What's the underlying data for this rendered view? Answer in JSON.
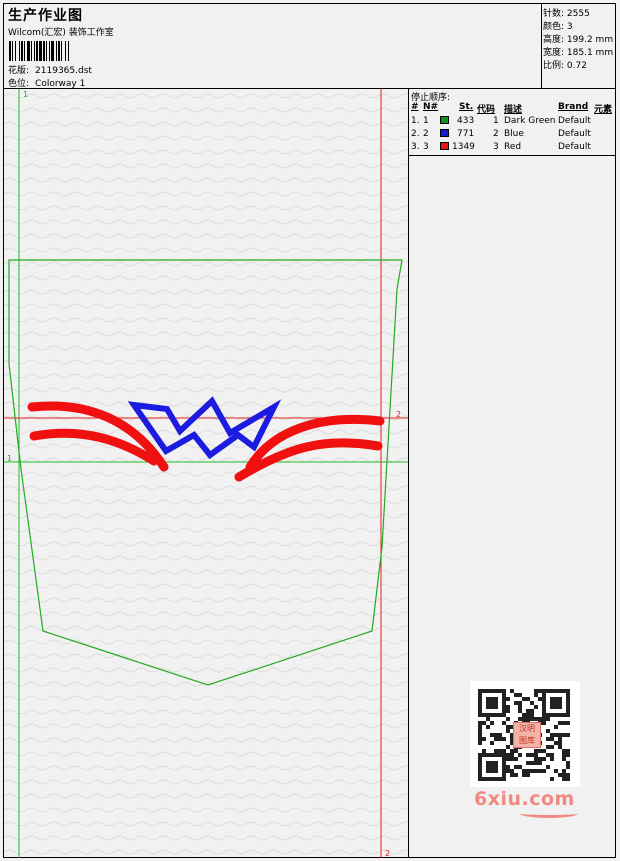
{
  "header": {
    "title": "生产作业图",
    "studio": "Wilcom(汇宏) 装饰工作室",
    "design_label": "花版:",
    "design_value": "2119365.dst",
    "colorway_label": "色位:",
    "colorway_value": "Colorway 1"
  },
  "stats": [
    {
      "label": "针数:",
      "value": "2555"
    },
    {
      "label": "颜色:",
      "value": "3"
    },
    {
      "label": "高度:",
      "value": "199.2 mm"
    },
    {
      "label": "宽度:",
      "value": "185.1 mm"
    },
    {
      "label": "比例:",
      "value": "0.72"
    }
  ],
  "stops": {
    "title": "停止顺序:",
    "columns": [
      "#",
      "N#",
      "St.",
      "代码",
      "描述",
      "Brand",
      "元素"
    ],
    "rows": [
      {
        "idx": "1.",
        "n": "1",
        "color": "#1a8a2a",
        "stitches": "433",
        "code": "1",
        "desc": "Dark Green",
        "brand": "Default"
      },
      {
        "idx": "2.",
        "n": "2",
        "color": "#1a1acc",
        "stitches": "771",
        "code": "2",
        "desc": "Blue",
        "brand": "Default"
      },
      {
        "idx": "3.",
        "n": "3",
        "color": "#e01818",
        "stitches": "1349",
        "code": "3",
        "desc": "Red",
        "brand": "Default"
      }
    ]
  },
  "guides": {
    "green_v_label": "1",
    "green_h_label": "1",
    "red_h_label": "2",
    "red_v_label": "2"
  },
  "colors": {
    "guide_green": "#22bb22",
    "guide_red": "#e02020",
    "pocket_green": "#22aa22",
    "red_thread": "#f01010",
    "blue_thread": "#1c1ce0"
  },
  "watermark": {
    "stamp_text": "汉明 图库",
    "brand": "6xiu.com"
  }
}
